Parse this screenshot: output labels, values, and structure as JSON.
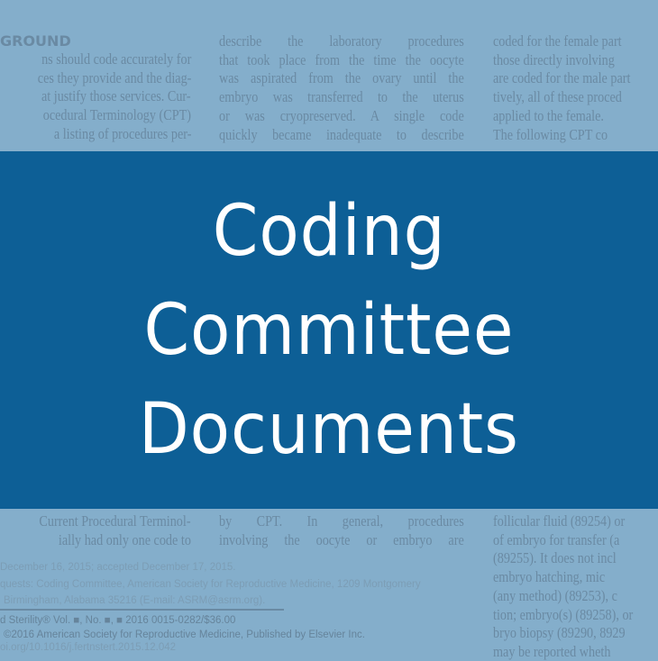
{
  "banner": {
    "title_lines": [
      "Coding",
      "Committee",
      "Documents"
    ]
  },
  "background_document": {
    "heading": "GROUND",
    "col1_top": [
      "ns should code accurately for",
      "ces they provide and the diag-",
      "at justify those services. Cur-",
      "ocedural Terminology (CPT)",
      "a listing of procedures per-"
    ],
    "col2_top": [
      "describe the laboratory procedures",
      "that took place from the time the oocyte",
      "was aspirated from the ovary until the",
      "embryo was transferred to the uterus",
      "or was cryopreserved. A single code",
      "quickly became inadequate to describe"
    ],
    "col3_top": [
      "coded for the female part",
      "those directly involving",
      "are coded for the male part",
      "tively, all of these proced",
      "applied to the female.",
      "    The following CPT co"
    ],
    "col1_bottom": [
      "Current Procedural Terminol-",
      "ially had only one code to"
    ],
    "col2_bottom": [
      "by CPT. In general, procedures",
      "involving the oocyte or embryo are"
    ],
    "col3_bottom": [
      "follicular fluid (89254) or",
      "of embryo for transfer (a",
      "(89255). It does not incl",
      "embryo hatching, mic",
      "(any method) (89253), c",
      "tion; embryo(s) (89258), or",
      "bryo biopsy (89290, 8929",
      "may be reported wheth"
    ],
    "footer": [
      "December 16, 2015; accepted December 17, 2015.",
      "quests: Coding Committee, American Society for Reproductive Medicine, 1209 Montgomery",
      "Birmingham, Alabama 35216 (E-mail: ASRM@asrm.org).",
      "d Sterility® Vol. ■, No. ■, ■ 2016 0015-0282/$36.00",
      "©2016 American Society for Reproductive Medicine, Published by Elsevier Inc.",
      "oi.org/10.1016/j.fertnstert.2015.12.042"
    ]
  }
}
